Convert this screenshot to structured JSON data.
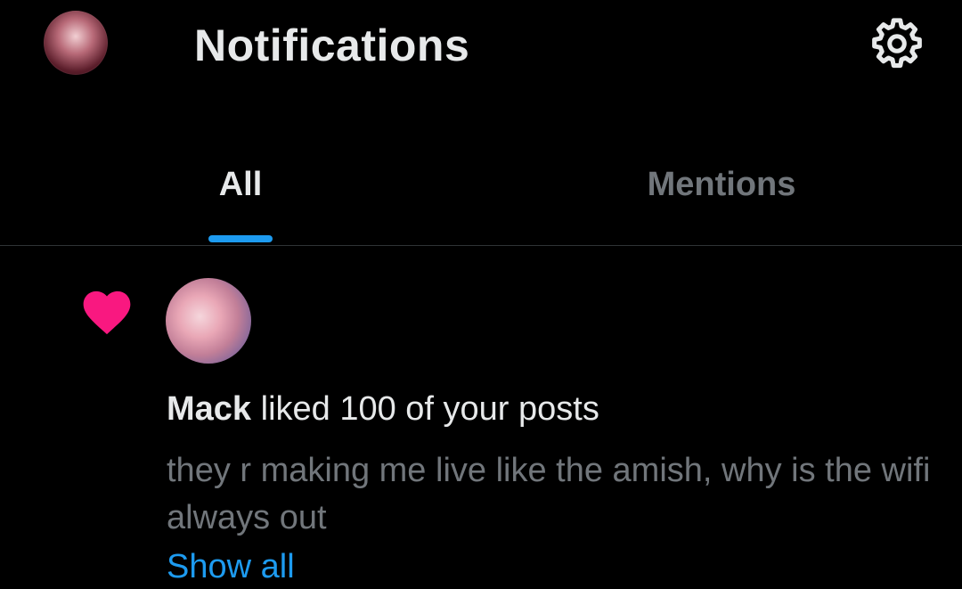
{
  "header": {
    "title": "Notifications",
    "avatar_icon": "profile-avatar",
    "settings_icon": "gear-icon"
  },
  "tabs": [
    {
      "label": "All",
      "active": true
    },
    {
      "label": "Mentions",
      "active": false
    }
  ],
  "notification": {
    "icon": "heart-icon",
    "icon_color": "#f91880",
    "user_name": "Mack",
    "action_text": " liked 100 of your posts",
    "post_text": "they r making me live like the amish, why is the wifi always out",
    "show_all_label": "Show all"
  },
  "colors": {
    "background": "#000000",
    "primary_text": "#e7e9ea",
    "secondary_text": "#71767b",
    "accent": "#1d9bf0",
    "divider": "#2f3336"
  }
}
